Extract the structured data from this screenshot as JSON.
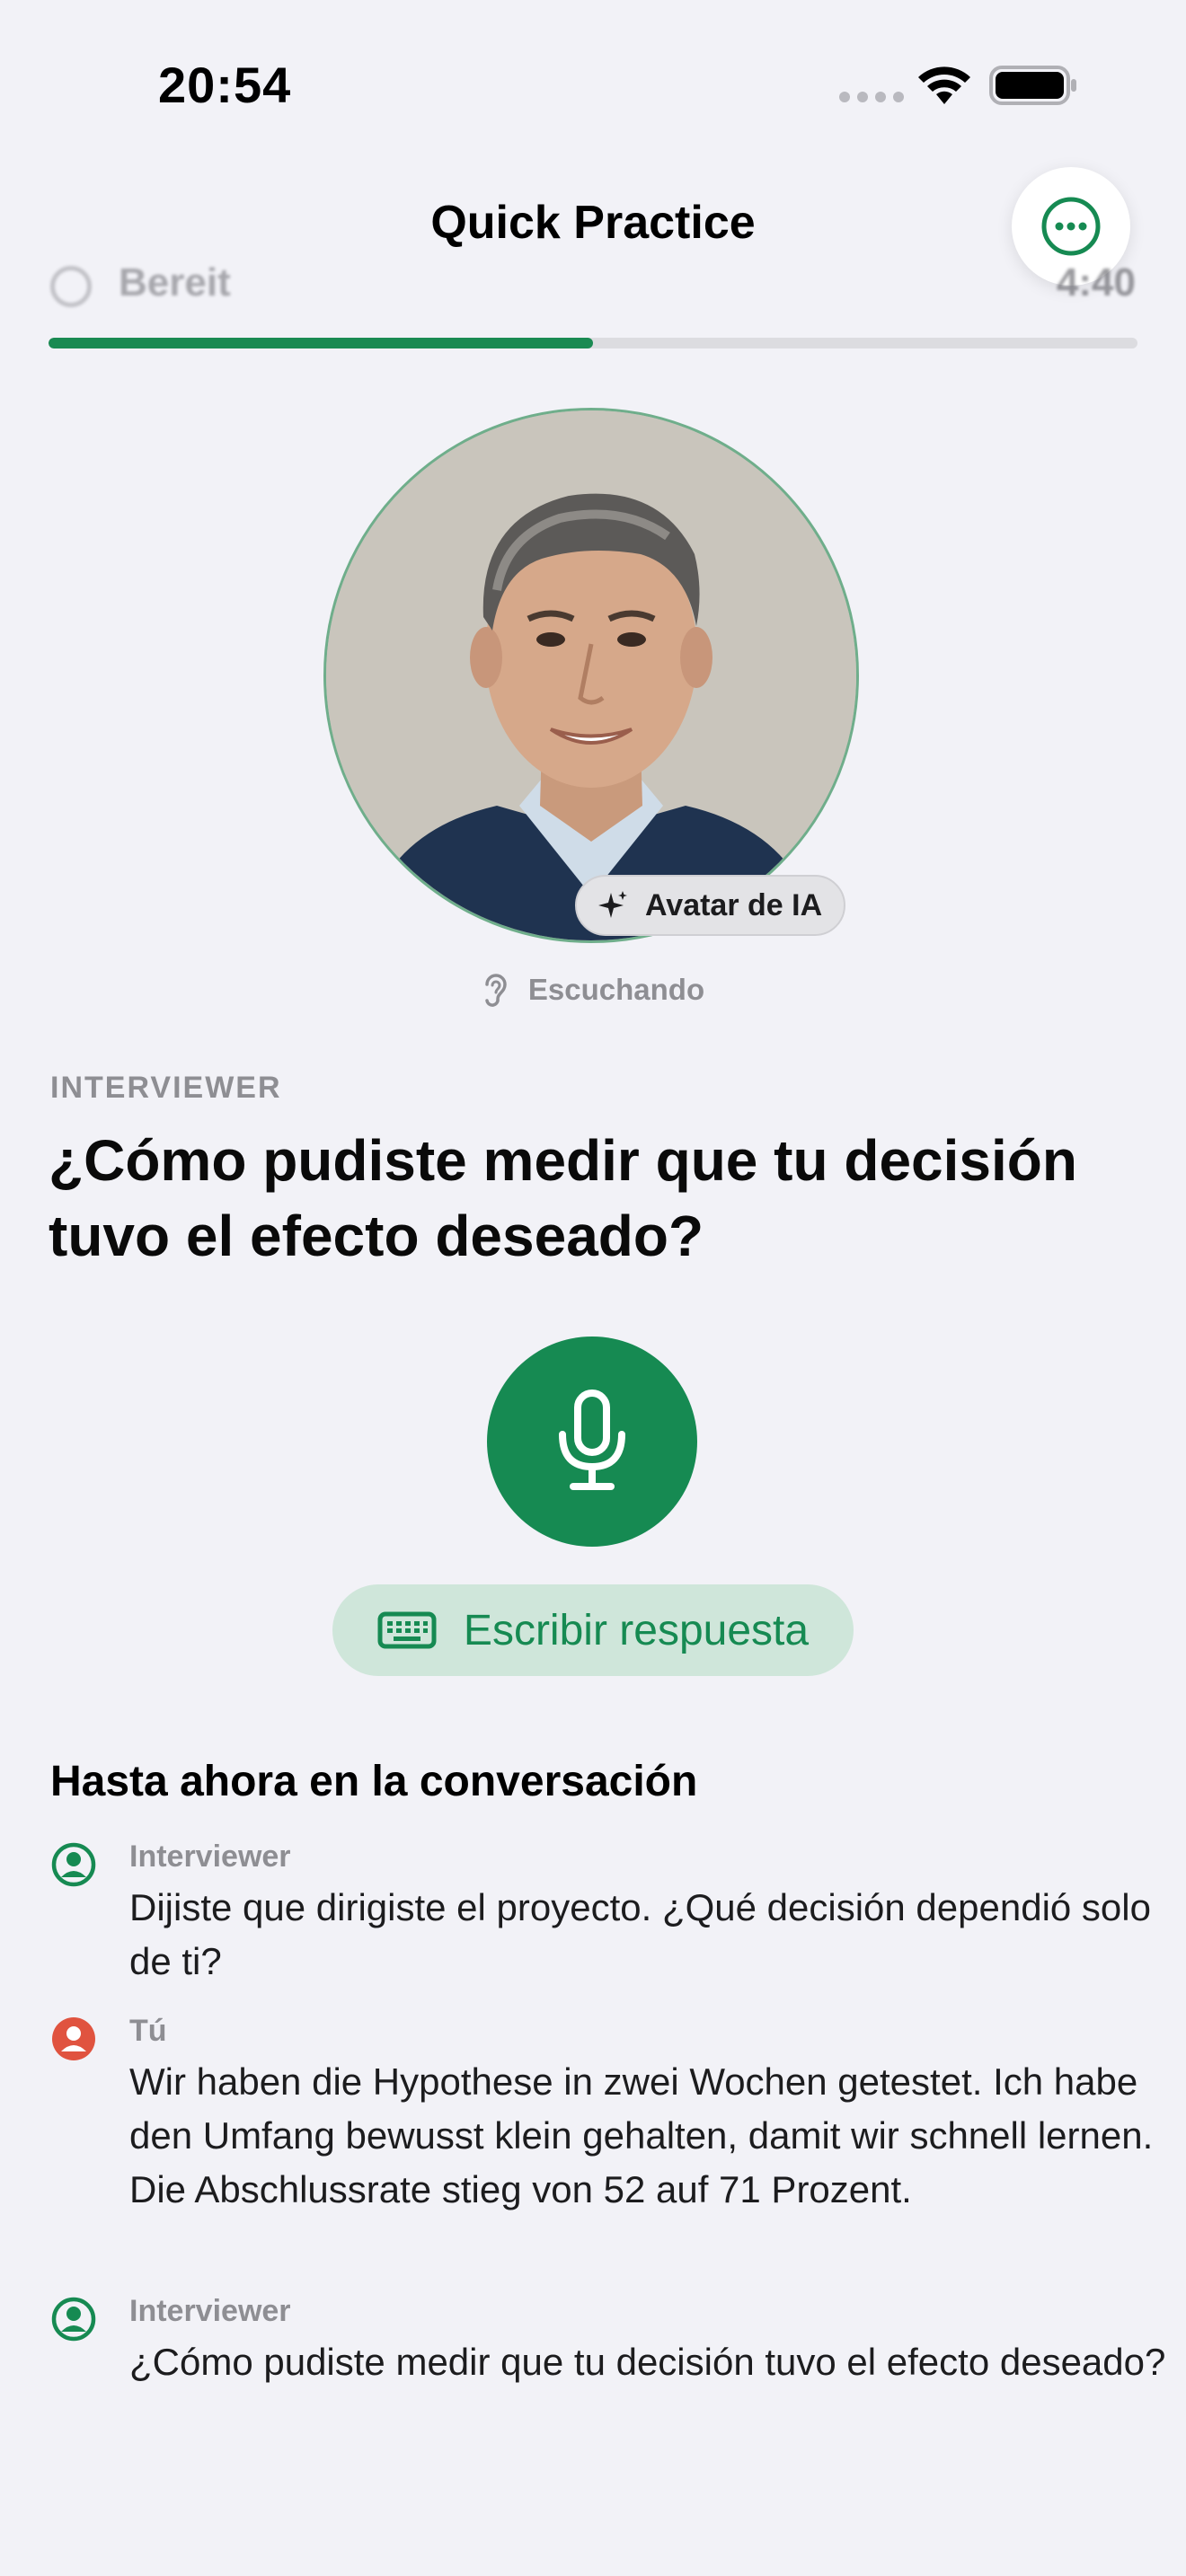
{
  "status_bar": {
    "time": "20:54"
  },
  "header": {
    "title": "Quick Practice",
    "status_label": "Bereit",
    "timer": "4:40",
    "progress": 0.5
  },
  "avatar": {
    "badge_label": "Avatar de IA",
    "listening_label": "Escuchando"
  },
  "question": {
    "role": "INTERVIEWER",
    "text": "¿Cómo pudiste medir que tu decisión tuvo el efecto deseado?"
  },
  "actions": {
    "write_label": "Escribir respuesta"
  },
  "conversation": {
    "title": "Hasta ahora en la conversación",
    "messages": [
      {
        "who": "Interviewer",
        "text": "Dijiste que dirigiste el proyecto. ¿Qué decisión dependió solo de ti?",
        "color": "#168a52"
      },
      {
        "who": "Tú",
        "text": "Wir haben die Hypothese in zwei Wochen getestet. Ich habe den Umfang bewusst klein gehalten, damit wir schnell lernen. Die Abschlussrate stieg von 52 auf 71 Prozent.",
        "color": "#e0533f"
      },
      {
        "who": "Interviewer",
        "text": "¿Cómo pudiste medir que tu decisión tuvo el efecto deseado?",
        "color": "#168a52"
      }
    ]
  },
  "colors": {
    "accent": "#168a52",
    "user": "#e0533f",
    "background": "#f2f2f7"
  },
  "icons": [
    "wifi-icon",
    "battery-icon",
    "more-icon",
    "sparkles-icon",
    "ear-icon",
    "microphone-icon",
    "keyboard-icon",
    "person-circle-icon"
  ]
}
